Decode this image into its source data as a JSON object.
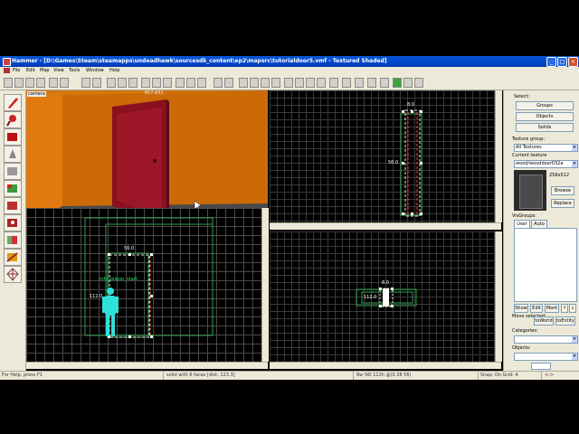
{
  "window": {
    "title": "Hammer - [D:\\Games\\Steam\\steamapps\\undeadhawk\\sourcesdk_content\\ep2\\mapsrc\\tutorialdoor5.vmf - Textured Shaded]"
  },
  "menu": [
    "File",
    "Edit",
    "Map",
    "View",
    "Tools",
    "Window",
    "Help"
  ],
  "viewports": {
    "camera_label": "camera",
    "camera_overlay": "857.851",
    "top_right": {
      "door_width": "8.0",
      "door_side": "56.0"
    },
    "bottom_left": {
      "door_width": "56.0",
      "entity_name": "info_player_start",
      "height": "112.0"
    },
    "bottom_right": {
      "door_width": "8.0",
      "height": "112.0"
    }
  },
  "panel": {
    "select_label": "Select:",
    "groups": "Groups",
    "objects": "Objects",
    "solids": "Solids",
    "texture_group_label": "Texture group:",
    "texture_group_value": "All Textures",
    "current_texture_label": "Current texture",
    "current_texture_value": "wood/wooddoor032a",
    "texture_size": "256x512",
    "browse": "Browse",
    "replace": "Replace",
    "visgroups_label": "VisGroups:",
    "tab_user": "User",
    "tab_auto": "Auto",
    "show": "Show",
    "edit": "Edit",
    "mark": "Mark",
    "move_selected_label": "Move selected:",
    "to_world": "toWorld",
    "to_entity": "toEntity",
    "categories_label": "Categories:",
    "objects_label": "Objects:"
  },
  "status": {
    "help": "For Help, press F1",
    "selection": "solid with 6 faces  [dist: 123.3]",
    "size": "8w 56l 112h @(0 28 56)",
    "snap": "Snap: On Grid: 4",
    "zoom": "<->"
  }
}
